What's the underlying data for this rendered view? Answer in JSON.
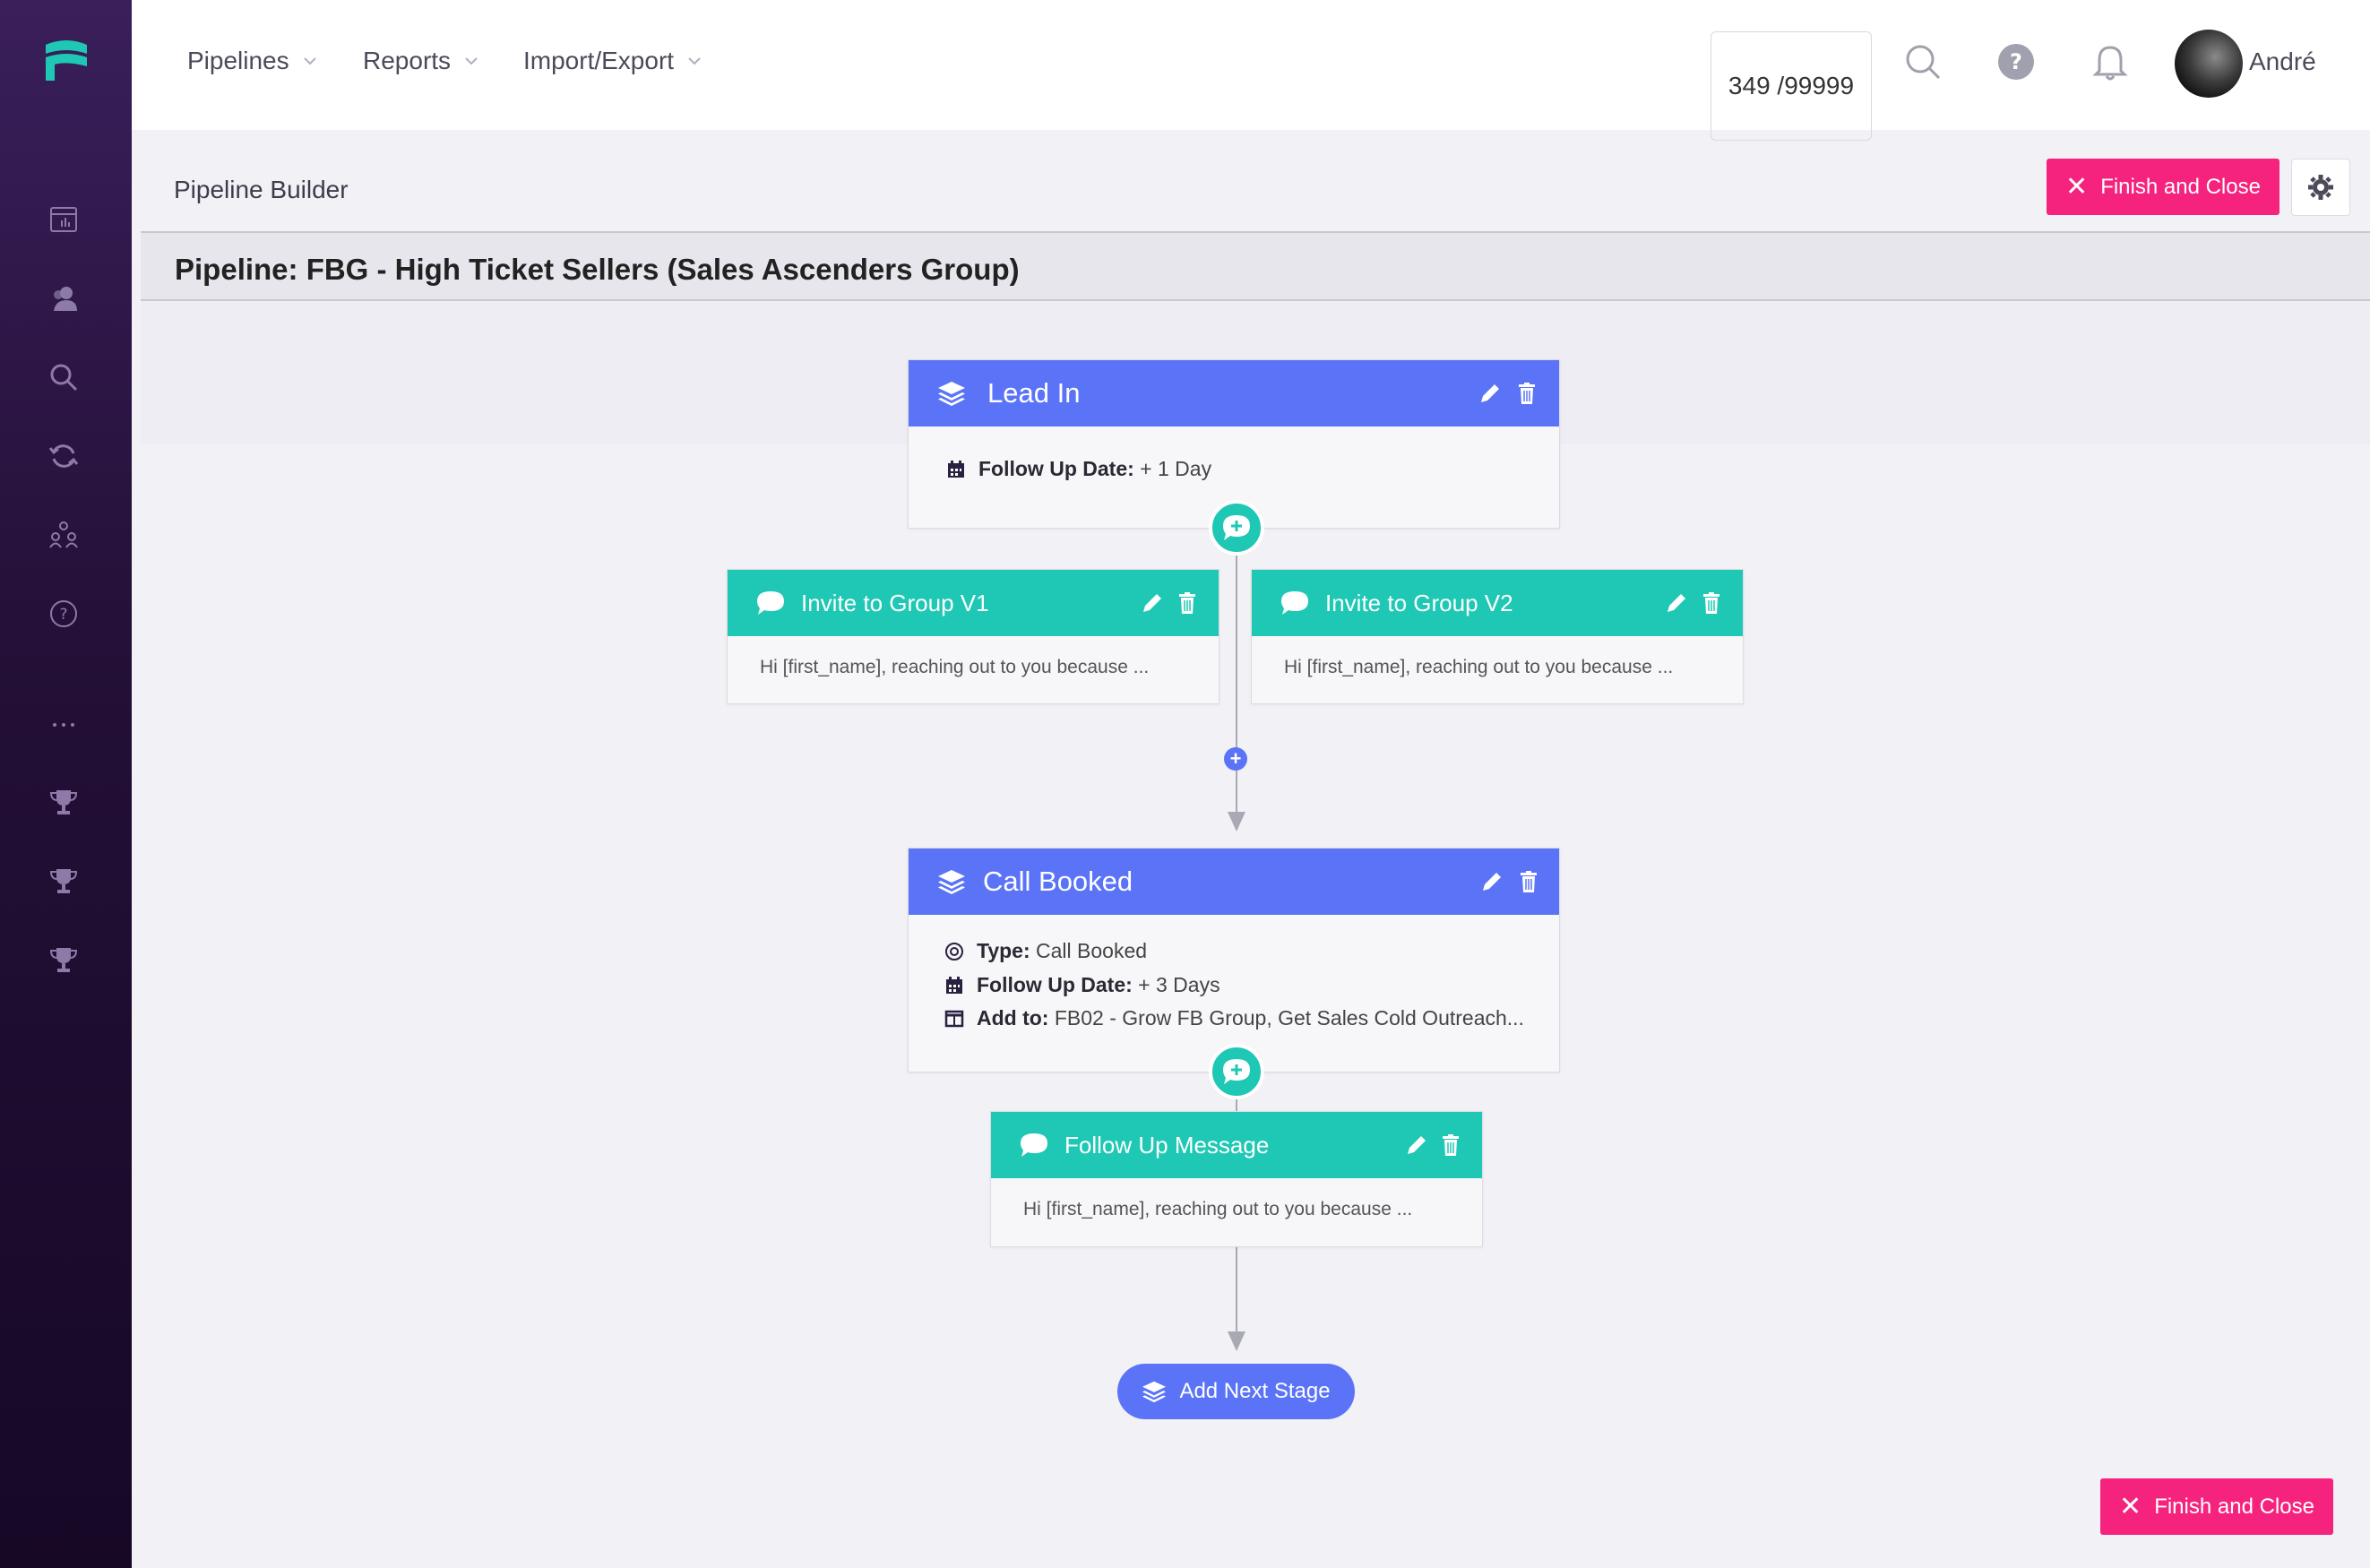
{
  "app": {
    "user_name": "André",
    "counter": "349 /99999"
  },
  "nav": {
    "items": [
      {
        "label": "Pipelines"
      },
      {
        "label": "Reports"
      },
      {
        "label": "Import/Export"
      }
    ]
  },
  "header": {
    "breadcrumb": "Pipeline Builder",
    "finish_label": "Finish and Close",
    "pipeline_title": "Pipeline: FBG - High Ticket Sellers (Sales Ascenders Group)"
  },
  "stages": [
    {
      "title": "Lead In",
      "rows": [
        {
          "key": "Follow Up Date:",
          "value": "+ 1 Day"
        }
      ]
    },
    {
      "title": "Call Booked",
      "rows": [
        {
          "key": "Type:",
          "value": "Call Booked"
        },
        {
          "key": "Follow Up Date:",
          "value": "+ 3 Days"
        },
        {
          "key": "Add to:",
          "value": "FB02 - Grow FB Group, Get Sales Cold Outreach..."
        }
      ]
    }
  ],
  "messages": [
    {
      "title": "Invite to Group V1",
      "preview": "Hi [first_name], reaching out to you because ..."
    },
    {
      "title": "Invite to Group V2",
      "preview": "Hi [first_name], reaching out to you because ..."
    },
    {
      "title": "Follow Up Message",
      "preview": "Hi [first_name], reaching out to you because ..."
    }
  ],
  "footer": {
    "add_stage_label": "Add Next Stage",
    "finish_label": "Finish and Close"
  },
  "colors": {
    "stage": "#5b74f7",
    "message": "#1ec8b4",
    "accent": "#f5237d",
    "sidebar": "#241038"
  }
}
